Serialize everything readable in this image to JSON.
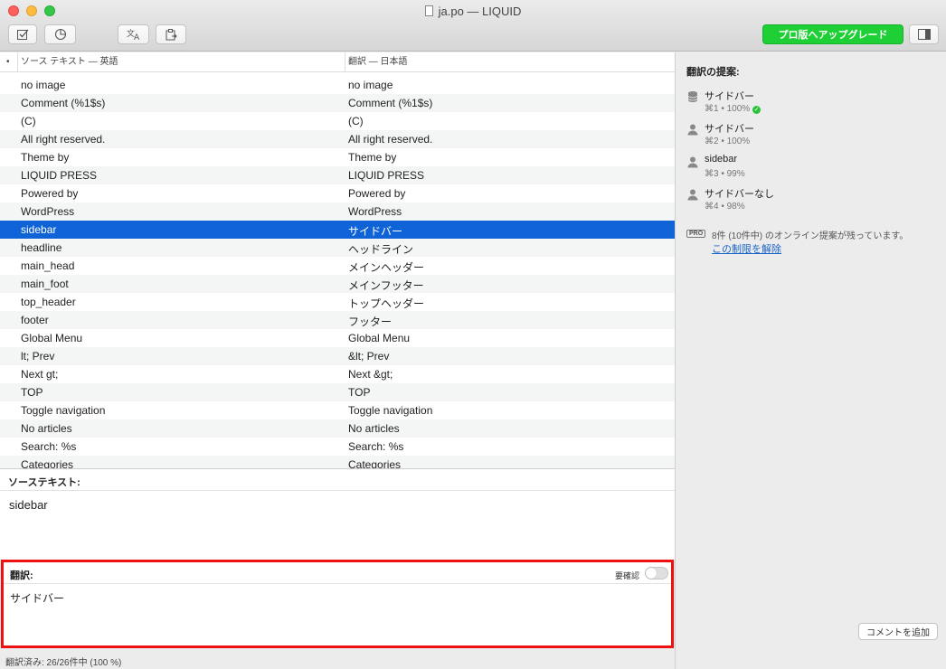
{
  "window": {
    "title": "ja.po — LIQUID"
  },
  "toolbar": {
    "upgrade_label": "プロ版へアップグレード"
  },
  "list": {
    "header_source": "ソース テキスト — 英語",
    "header_translation": "翻訳 — 日本語",
    "rows": [
      {
        "source": "no image",
        "translation": "no image"
      },
      {
        "source": "Comment (%1$s)",
        "translation": "Comment (%1$s)"
      },
      {
        "source": "(C)",
        "translation": "(C)"
      },
      {
        "source": "All right reserved.",
        "translation": "All right reserved."
      },
      {
        "source": "Theme by",
        "translation": "Theme by"
      },
      {
        "source": "LIQUID PRESS",
        "translation": "LIQUID PRESS"
      },
      {
        "source": "Powered by",
        "translation": "Powered by"
      },
      {
        "source": "WordPress",
        "translation": "WordPress"
      },
      {
        "source": "sidebar",
        "translation": "サイドバー"
      },
      {
        "source": "headline",
        "translation": "ヘッドライン"
      },
      {
        "source": "main_head",
        "translation": "メインヘッダー"
      },
      {
        "source": "main_foot",
        "translation": "メインフッター"
      },
      {
        "source": "top_header",
        "translation": "トップヘッダー"
      },
      {
        "source": "footer",
        "translation": "フッター"
      },
      {
        "source": "Global Menu",
        "translation": "Global Menu"
      },
      {
        "source": "lt; Prev",
        "translation": "&lt; Prev"
      },
      {
        "source": "Next gt;",
        "translation": "Next &gt;"
      },
      {
        "source": "TOP",
        "translation": "TOP"
      },
      {
        "source": "Toggle navigation",
        "translation": "Toggle navigation"
      },
      {
        "source": "No articles",
        "translation": "No articles"
      },
      {
        "source": "Search: %s",
        "translation": "Search: %s"
      },
      {
        "source": "Categories",
        "translation": "Categories"
      }
    ]
  },
  "source_panel": {
    "label": "ソーステキスト:",
    "text": "sidebar"
  },
  "translation_panel": {
    "label": "翻訳:",
    "needs_review_label": "要確認",
    "text": "サイドバー"
  },
  "status": {
    "text": "翻訳済み: 26/26件中 (100 %)"
  },
  "sidebar": {
    "title": "翻訳の提案:",
    "suggestions": [
      {
        "icon": "database-icon",
        "text": "サイドバー",
        "meta": "⌘1 • 100%"
      },
      {
        "icon": "person-icon",
        "text": "サイドバー",
        "meta": "⌘2 • 100%"
      },
      {
        "icon": "person-icon",
        "text": "sidebar",
        "meta": "⌘3 • 99%"
      },
      {
        "icon": "person-icon",
        "text": "サイドバーなし",
        "meta": "⌘4 • 98%"
      }
    ],
    "pro_badge": "PRO",
    "pro_note": "8件 (10件中) のオンライン提案が残っています。",
    "unlock_link": "この制限を解除",
    "add_comment_label": "コメントを追加"
  }
}
